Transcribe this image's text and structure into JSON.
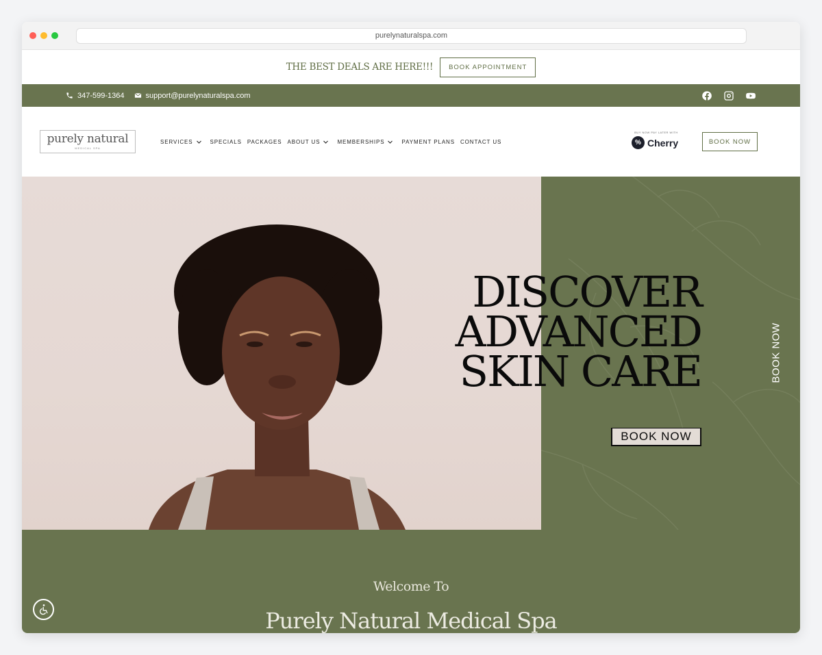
{
  "browser": {
    "url": "purelynaturalspa.com"
  },
  "promo": {
    "text": "THE BEST DEALS ARE HERE!!!",
    "button": "BOOK APPOINTMENT"
  },
  "topbar": {
    "phone": "347-599-1364",
    "email": "support@purelynaturalspa.com",
    "socials": [
      "facebook-icon",
      "instagram-icon",
      "youtube-icon"
    ]
  },
  "nav": {
    "logo": {
      "main": "purely natural",
      "sub": "MEDICAL SPA"
    },
    "menu": [
      {
        "label": "SERVICES",
        "dropdown": true
      },
      {
        "label": "SPECIALS",
        "dropdown": false
      },
      {
        "label": "PACKAGES",
        "dropdown": false
      },
      {
        "label": "ABOUT US",
        "dropdown": true
      },
      {
        "label": "MEMBERSHIPS",
        "dropdown": true
      },
      {
        "label": "PAYMENT PLANS",
        "dropdown": false
      },
      {
        "label": "CONTACT US",
        "dropdown": false
      }
    ],
    "cherry": {
      "tagline": "BUY NOW PAY LATER WITH",
      "name": "Cherry",
      "mark": "%"
    },
    "book_button": "BOOK NOW"
  },
  "hero": {
    "title_lines": [
      "DISCOVER",
      "ADVANCED",
      "SKIN CARE"
    ],
    "button": "BOOK NOW",
    "side_button": "BOOK NOW"
  },
  "welcome": {
    "sub": "Welcome To",
    "title": "Purely Natural Medical Spa"
  },
  "colors": {
    "brand_green": "#69744f",
    "text_dark": "#0a0a0a",
    "hero_bg": "#e6dad6"
  }
}
